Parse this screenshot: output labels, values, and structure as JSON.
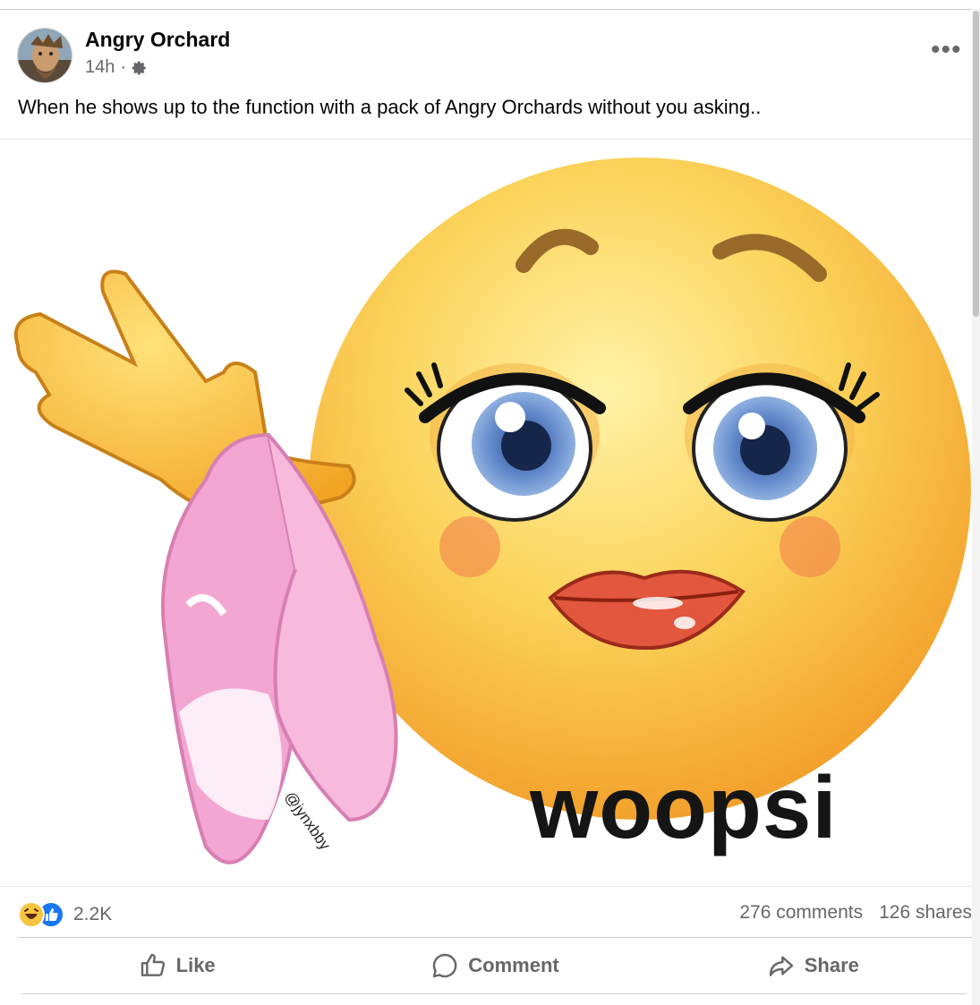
{
  "post": {
    "author": "Angry Orchard",
    "time": "14h",
    "separator": "·",
    "caption": "When he shows up to the function with a pack of Angry Orchards without you asking..",
    "more_label": "•••"
  },
  "media": {
    "meme_text": "woopsi",
    "watermark": "@jynxbby"
  },
  "stats": {
    "reaction_count": "2.2K",
    "comments": "276 comments",
    "shares": "126 shares"
  },
  "actions": {
    "like": "Like",
    "comment": "Comment",
    "share": "Share"
  },
  "colors": {
    "accent": "#1877f2",
    "secondary_text": "#65676b",
    "emoji_yellow": "#f7b733",
    "panties_pink": "#f3a6d2"
  },
  "icons": {
    "gear": "gear-icon",
    "more": "more-icon",
    "like": "thumbs-up-icon",
    "comment": "comment-bubble-icon",
    "share": "share-arrow-icon",
    "haha": "haha-reaction-icon",
    "like_reaction": "like-reaction-icon"
  }
}
